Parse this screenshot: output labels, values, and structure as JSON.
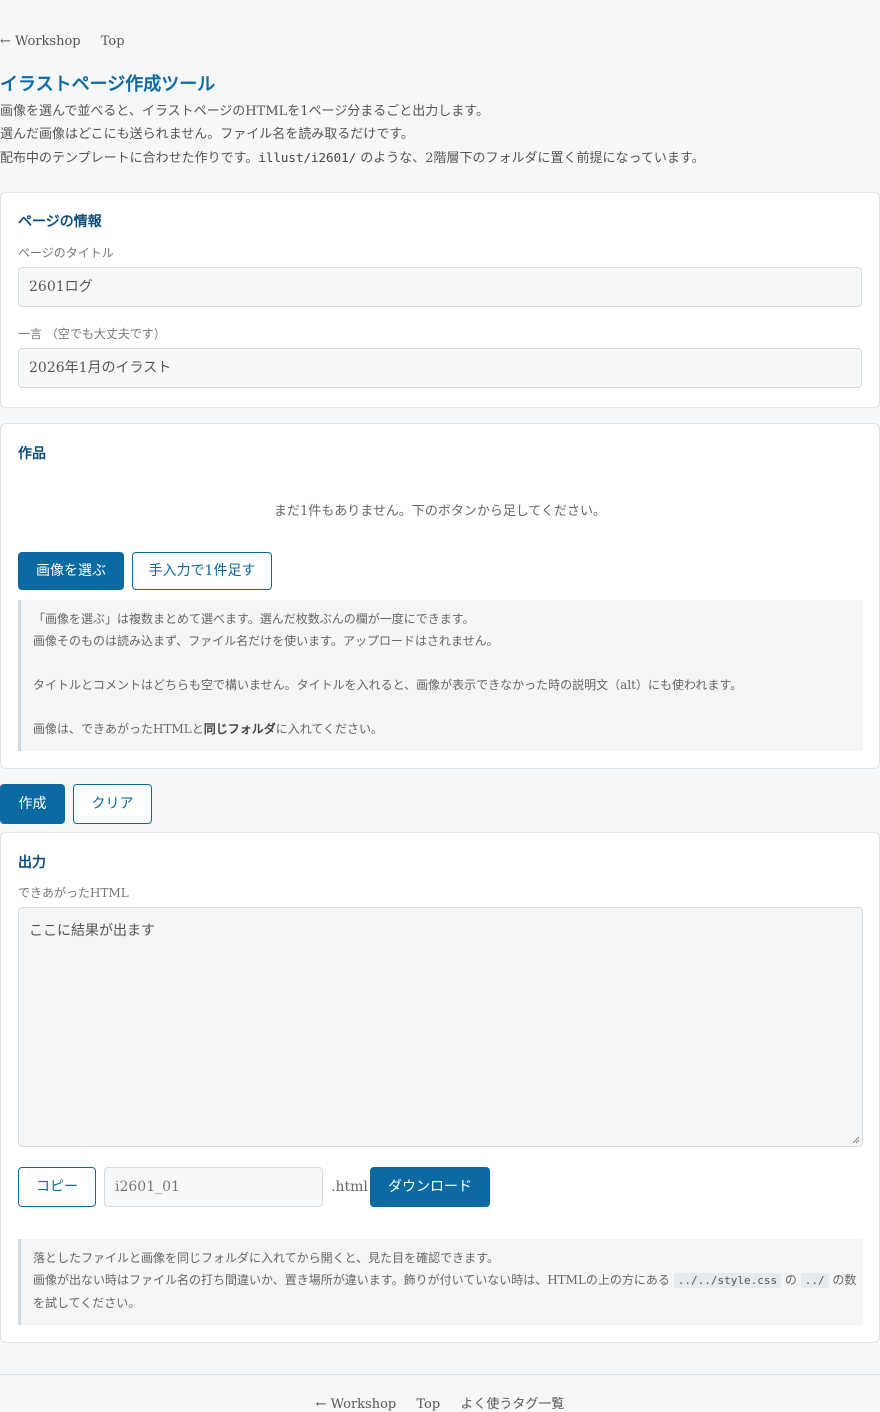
{
  "topnav": {
    "back": "← Workshop",
    "top": "Top"
  },
  "header": {
    "title": "イラストページ作成ツール",
    "intro1": "画像を選んで並べると、イラストページのHTMLを1ページ分まるごと出力します。",
    "intro2": "選んだ画像はどこにも送られません。ファイル名を読み取るだけです。",
    "intro3_pre": "配布中のテンプレートに合わせた作りです。",
    "intro3_code": "illust/i2601/",
    "intro3_post": " のような、2階層下のフォルダに置く前提になっています。"
  },
  "page_info": {
    "heading": "ページの情報",
    "title_label": "ページのタイトル",
    "title_value": "2601ログ",
    "comment_label": "一言 （空でも大丈夫です）",
    "comment_value": "2026年1月のイラスト"
  },
  "works": {
    "heading": "作品",
    "empty": "まだ1件もありません。下のボタンから足してください。",
    "choose_button": "画像を選ぶ",
    "manual_button": "手入力で1件足す",
    "note1": "「画像を選ぶ」は複数まとめて選べます。選んだ枚数ぶんの欄が一度にできます。",
    "note2": "画像そのものは読み込まず、ファイル名だけを使います。アップロードはされません。",
    "note3": "タイトルとコメントはどちらも空で構いません。タイトルを入れると、画像が表示できなかった時の説明文（alt）にも使われます。",
    "note4_pre": "画像は、できあがったHTMLと",
    "note4_bold": "同じフォルダ",
    "note4_post": "に入れてください。"
  },
  "actions": {
    "create": "作成",
    "clear": "クリア"
  },
  "output": {
    "heading": "出力",
    "label": "できあがったHTML",
    "placeholder": "ここに結果が出ます",
    "copy_button": "コピー",
    "filename": "i2601_01",
    "ext": ".html",
    "download_button": "ダウンロード",
    "tip1": "落としたファイルと画像を同じフォルダに入れてから開くと、見た目を確認できます。",
    "tip2_pre": "画像が出ない時はファイル名の打ち間違いか、置き場所が違います。飾りが付いていない時は、HTMLの上の方にある ",
    "tip2_code1": "../../style.css",
    "tip2_mid": " の ",
    "tip2_code2": "../",
    "tip2_post": " の数",
    "tip3": "を試してください。"
  },
  "footer": {
    "back": "← Workshop",
    "top": "Top",
    "tags": "よく使うタグ一覧"
  },
  "colors": {
    "accent": "#0b6aa1",
    "heading": "#0e4e7a",
    "background": "#f5f7f9"
  }
}
